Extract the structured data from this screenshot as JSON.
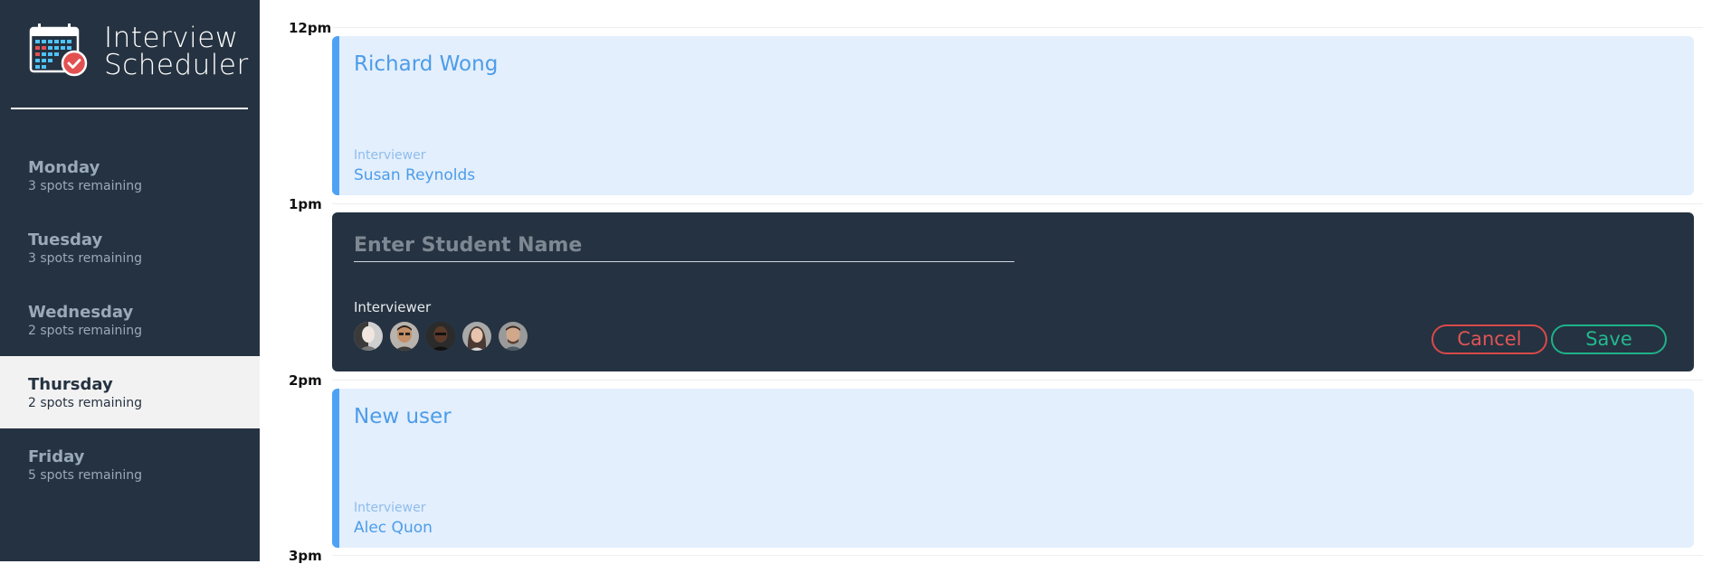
{
  "app": {
    "title_line1": "Interview",
    "title_line2": "Scheduler",
    "logo_icon": "calendar-check-icon"
  },
  "sidebar": {
    "days": [
      {
        "name": "Monday",
        "spots": "3 spots remaining",
        "selected": false
      },
      {
        "name": "Tuesday",
        "spots": "3 spots remaining",
        "selected": false
      },
      {
        "name": "Wednesday",
        "spots": "2 spots remaining",
        "selected": false
      },
      {
        "name": "Thursday",
        "spots": "2 spots remaining",
        "selected": true
      },
      {
        "name": "Friday",
        "spots": "5 spots remaining",
        "selected": false
      }
    ]
  },
  "schedule": {
    "times": [
      "12pm",
      "1pm",
      "2pm",
      "3pm"
    ],
    "appointments": [
      {
        "type": "show",
        "student": "Richard Wong",
        "interviewer_label": "Interviewer",
        "interviewer": "Susan Reynolds"
      },
      {
        "type": "form",
        "placeholder": "Enter Student Name",
        "value": "",
        "interviewer_label": "Interviewer",
        "interviewers": [
          {
            "icon": "interviewer-avatar-1"
          },
          {
            "icon": "interviewer-avatar-2"
          },
          {
            "icon": "interviewer-avatar-3"
          },
          {
            "icon": "interviewer-avatar-4"
          },
          {
            "icon": "interviewer-avatar-5"
          }
        ],
        "cancel_label": "Cancel",
        "save_label": "Save"
      },
      {
        "type": "show",
        "student": "New user",
        "interviewer_label": "Interviewer",
        "interviewer": "Alec Quon"
      }
    ]
  },
  "colors": {
    "sidebar_bg": "#253241",
    "accent_blue": "#4ea2f6",
    "card_bg": "#e3effd",
    "cancel_red": "#d84a4a",
    "save_green": "#1fb189"
  }
}
